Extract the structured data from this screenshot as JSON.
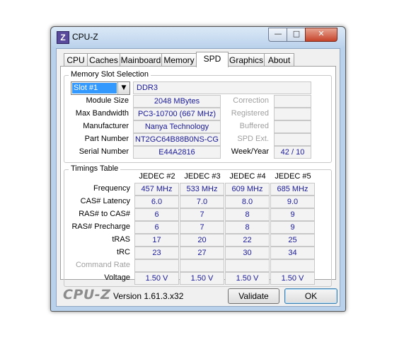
{
  "window": {
    "title": "CPU-Z",
    "icon_letter": "Z",
    "min_glyph": "—",
    "max_glyph": "□",
    "close_glyph": "✕"
  },
  "tabs": [
    "CPU",
    "Caches",
    "Mainboard",
    "Memory",
    "SPD",
    "Graphics",
    "About"
  ],
  "active_tab": "SPD",
  "slot": {
    "group_title": "Memory Slot Selection",
    "selected": "Slot #1",
    "type": "DDR3",
    "labels": {
      "module_size": "Module Size",
      "max_bandwidth": "Max Bandwidth",
      "manufacturer": "Manufacturer",
      "part_number": "Part Number",
      "serial_number": "Serial Number",
      "correction": "Correction",
      "registered": "Registered",
      "buffered": "Buffered",
      "spd_ext": "SPD Ext.",
      "week_year": "Week/Year"
    },
    "values": {
      "module_size": "2048 MBytes",
      "max_bandwidth": "PC3-10700 (667 MHz)",
      "manufacturer": "Nanya Technology",
      "part_number": "NT2GC64B88B0NS-CG",
      "serial_number": "E44A2816",
      "correction": "",
      "registered": "",
      "buffered": "",
      "spd_ext": "",
      "week_year": "42 / 10"
    }
  },
  "timings": {
    "group_title": "Timings Table",
    "columns": [
      "JEDEC #2",
      "JEDEC #3",
      "JEDEC #4",
      "JEDEC #5"
    ],
    "rows": [
      {
        "label": "Frequency",
        "values": [
          "457 MHz",
          "533 MHz",
          "609 MHz",
          "685 MHz"
        ]
      },
      {
        "label": "CAS# Latency",
        "values": [
          "6.0",
          "7.0",
          "8.0",
          "9.0"
        ]
      },
      {
        "label": "RAS# to CAS#",
        "values": [
          "6",
          "7",
          "8",
          "9"
        ]
      },
      {
        "label": "RAS# Precharge",
        "values": [
          "6",
          "7",
          "8",
          "9"
        ]
      },
      {
        "label": "tRAS",
        "values": [
          "17",
          "20",
          "22",
          "25"
        ]
      },
      {
        "label": "tRC",
        "values": [
          "23",
          "27",
          "30",
          "34"
        ]
      },
      {
        "label": "Command Rate",
        "values": [
          "",
          "",
          "",
          ""
        ]
      },
      {
        "label": "Voltage",
        "values": [
          "1.50 V",
          "1.50 V",
          "1.50 V",
          "1.50 V"
        ]
      }
    ]
  },
  "footer": {
    "logo": "CPU-Z",
    "version": "Version 1.61.3.x32",
    "validate_label": "Validate",
    "ok_label": "OK"
  }
}
